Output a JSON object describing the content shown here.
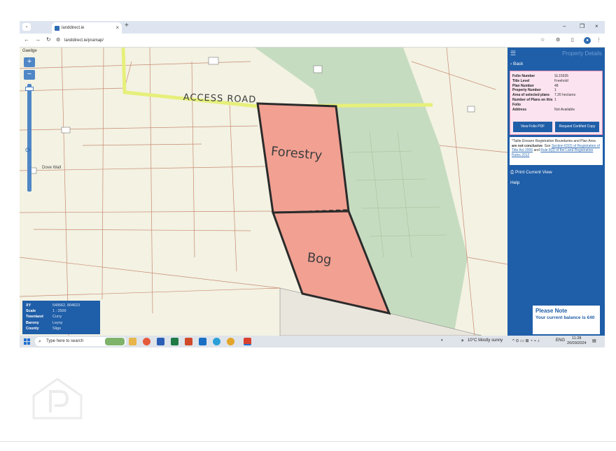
{
  "browser": {
    "tab_title": "landdirect.ie",
    "tab_close": "×",
    "new_tab": "+",
    "url": "landdirect.ie/pramap/",
    "window_controls": [
      "–",
      "❐",
      "×"
    ]
  },
  "map": {
    "language_toggle": "Gaeilge",
    "zoom_in": "+",
    "zoom_out": "−",
    "place_label": "Dove Wall",
    "handwritten": {
      "road": "ACCESS ROAD",
      "upper_parcel": "Forestry",
      "lower_parcel": "Bog"
    },
    "info": [
      {
        "key": "XY",
        "value": "549562, 804623"
      },
      {
        "key": "Scale",
        "value": "1 : 2500"
      },
      {
        "key": "Townland",
        "value": "Curry"
      },
      {
        "key": "Barony",
        "value": "Leyny"
      },
      {
        "key": "County",
        "value": "Sligo"
      }
    ],
    "colors": {
      "parcel_fill": "#f1a092",
      "parcel_outline": "#2b2b2b",
      "forest": "#c6dcc0",
      "road_highlight": "#e6f07a",
      "background": "#f3f2e3"
    }
  },
  "panel": {
    "title": "Property Details",
    "back": "Back",
    "folio": [
      {
        "key": "Folio Number",
        "value": "SL15935"
      },
      {
        "key": "Title Level",
        "value": "Freehold"
      },
      {
        "key": "Plan Number",
        "value": "48"
      },
      {
        "key": "Property Number",
        "value": "1"
      },
      {
        "key": "Area of selected plans",
        "value": "7.26 hectares"
      },
      {
        "key": "Number of Plans on this Folio",
        "value": "1"
      },
      {
        "key": "Address",
        "value": "Not Available"
      }
    ],
    "view_pdf": "View Folio PDF",
    "request_copy": "Request Certified Copy",
    "note_prefix": "*Tailte Éireann Registration Boundaries and Plan Area ",
    "note_bold": "are not conclusive",
    "note_mid": ". See ",
    "note_link1": "Section 62(2) of Registration of Title Act 2006",
    "note_and": " and ",
    "note_link2": "Rule 8(3) of the Land Registration Rules 2012",
    "print": "Print Current View",
    "help": "Help",
    "please_note_title": "Please Note",
    "please_note_body": "Your current balance is €40"
  },
  "taskbar": {
    "search_placeholder": "Type here to search",
    "weather": "10°C  Mostly sunny",
    "language": "ENG",
    "time": "11:28",
    "date": "20/03/2024"
  }
}
